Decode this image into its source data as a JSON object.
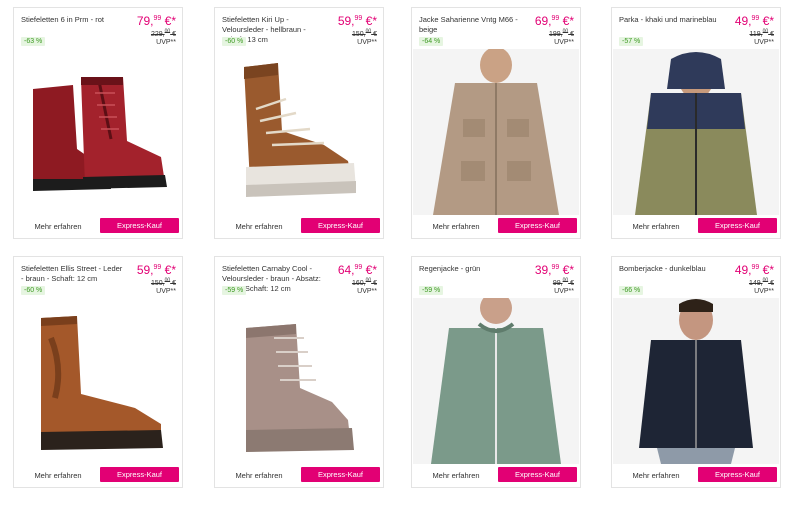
{
  "products": [
    {
      "name": "Stiefeletten 6 in Prm - rot",
      "price_main": "79,",
      "price_cents": "99",
      "price_suffix": " €*",
      "old_price": "229,",
      "old_cents": "00",
      "old_suffix": " €",
      "uvp": "UVP**",
      "discount": "-63 %",
      "more": "Mehr erfahren",
      "buy": "Express-Kauf",
      "image": "red-boot-image"
    },
    {
      "name": "Stiefeletten Kiri Up - Veloursleder - hellbraun - Schaft: 13 cm",
      "price_main": "59,",
      "price_cents": "99",
      "price_suffix": " €*",
      "old_price": "150,",
      "old_cents": "00",
      "old_suffix": " €",
      "uvp": "UVP**",
      "discount": "-60 %",
      "more": "Mehr erfahren",
      "buy": "Express-Kauf",
      "image": "tan-sneaker-boot-image"
    },
    {
      "name": "Jacke Saharienne Vntg M66 - beige",
      "price_main": "69,",
      "price_cents": "99",
      "price_suffix": " €*",
      "old_price": "199,",
      "old_cents": "00",
      "old_suffix": " €",
      "uvp": "UVP**",
      "discount": "-64 %",
      "more": "Mehr erfahren",
      "buy": "Express-Kauf",
      "image": "beige-jacket-image"
    },
    {
      "name": "Parka - khaki und marineblau",
      "price_main": "49,",
      "price_cents": "99",
      "price_suffix": " €*",
      "old_price": "119,",
      "old_cents": "00",
      "old_suffix": " €",
      "uvp": "UVP**",
      "discount": "-57 %",
      "more": "Mehr erfahren",
      "buy": "Express-Kauf",
      "image": "khaki-parka-image"
    },
    {
      "name": "Stiefeletten Ellis Street - Leder - braun - Schaft: 12 cm",
      "price_main": "59,",
      "price_cents": "99",
      "price_suffix": " €*",
      "old_price": "150,",
      "old_cents": "00",
      "old_suffix": " €",
      "uvp": "UVP**",
      "discount": "-60 %",
      "more": "Mehr erfahren",
      "buy": "Express-Kauf",
      "image": "brown-chelsea-boot-image"
    },
    {
      "name": "Stiefeletten Carnaby Cool - Veloursleder - braun - Absatz: 4 cm - Schaft: 12 cm",
      "price_main": "64,",
      "price_cents": "99",
      "price_suffix": " €*",
      "old_price": "160,",
      "old_cents": "00",
      "old_suffix": " €",
      "uvp": "UVP**",
      "discount": "-59 %",
      "more": "Mehr erfahren",
      "buy": "Express-Kauf",
      "image": "taupe-boot-image"
    },
    {
      "name": "Regenjacke - grün",
      "price_main": "39,",
      "price_cents": "99",
      "price_suffix": " €*",
      "old_price": "99,",
      "old_cents": "00",
      "old_suffix": " €",
      "uvp": "UVP**",
      "discount": "-59 %",
      "more": "Mehr erfahren",
      "buy": "Express-Kauf",
      "image": "green-rain-jacket-image"
    },
    {
      "name": "Bomberjacke - dunkelblau",
      "price_main": "49,",
      "price_cents": "99",
      "price_suffix": " €*",
      "old_price": "149,",
      "old_cents": "00",
      "old_suffix": " €",
      "uvp": "UVP**",
      "discount": "-66 %",
      "more": "Mehr erfahren",
      "buy": "Express-Kauf",
      "image": "navy-bomber-image"
    }
  ],
  "colors": {
    "accent": "#e20074",
    "discount_text": "#3d9a22",
    "discount_bg": "#e6f5e1"
  }
}
